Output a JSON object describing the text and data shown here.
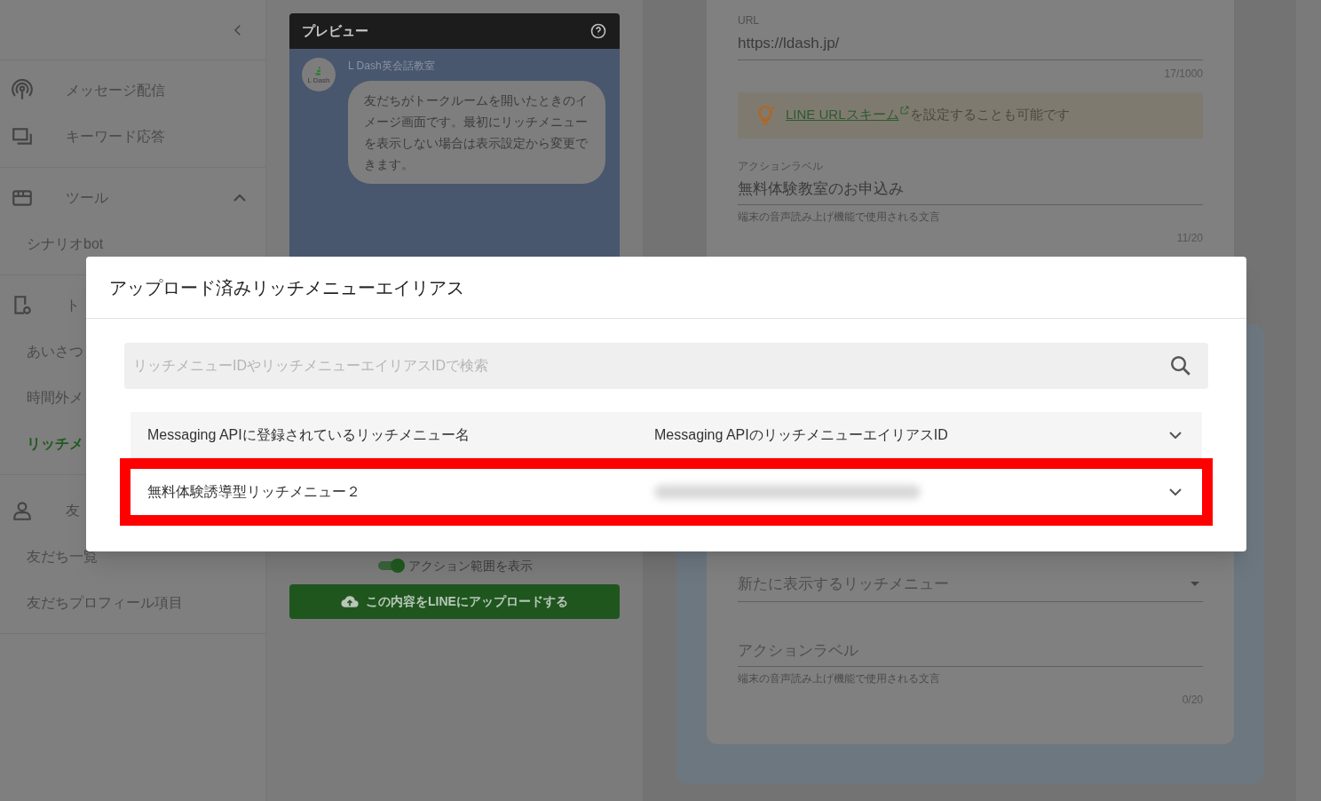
{
  "sidebar": {
    "sections": [
      {
        "items": [
          {
            "label": "メッセージ配信"
          },
          {
            "label": "キーワード応答"
          }
        ]
      },
      {
        "label": "ツール",
        "expanded": true,
        "children": [
          {
            "label": "シナリオbot",
            "selected": false
          }
        ]
      },
      {
        "label": "ト",
        "children": [
          {
            "label": "あいさつ",
            "selected": false
          },
          {
            "label": "時間外メ",
            "selected": false
          },
          {
            "label": "リッチメ",
            "selected": true
          }
        ]
      },
      {
        "label": "友",
        "children": [
          {
            "label": "友だち一覧",
            "selected": false
          },
          {
            "label": "友だちプロフィール項目",
            "selected": false
          }
        ]
      }
    ]
  },
  "preview": {
    "title": "プレビュー",
    "avatar_label": "L Dash",
    "account": "L Dash英会話教室",
    "message": "友だちがトークルームを開いたときのイメージ画面です。最初にリッチメニューを表示しない場合は表示設定から変更できます。",
    "toggle": {
      "label": "アクション範囲を表示",
      "on": true
    },
    "upload_button": "この内容をLINEにアップロードする"
  },
  "action_form": {
    "url": {
      "label": "URL",
      "value": "https://ldash.jp/",
      "counter": "17/1000"
    },
    "tip": {
      "link": "LINE URLスキーム",
      "text": "を設定することも可能です"
    },
    "action_label": {
      "label": "アクションラベル",
      "value": "無料体験教室のお申込み",
      "helper": "端末の音声読み上げ機能で使用される文言",
      "counter": "11/20"
    }
  },
  "second_form": {
    "select": {
      "placeholder": "新たに表示するリッチメニュー"
    },
    "action_label": {
      "placeholder": "アクションラベル",
      "helper": "端末の音声読み上げ機能で使用される文言",
      "counter": "0/20"
    }
  },
  "dialog": {
    "title": "アップロード済みリッチメニューエイリアス",
    "search": {
      "placeholder": "リッチメニューIDやリッチメニューエイリアスIDで検索"
    },
    "table": {
      "columns": [
        "Messaging APIに登録されているリッチメニュー名",
        "Messaging APIのリッチメニューエイリアスID"
      ],
      "rows": [
        {
          "name": "無料体験誘導型リッチメニュー２",
          "highlighted": true
        }
      ]
    }
  }
}
